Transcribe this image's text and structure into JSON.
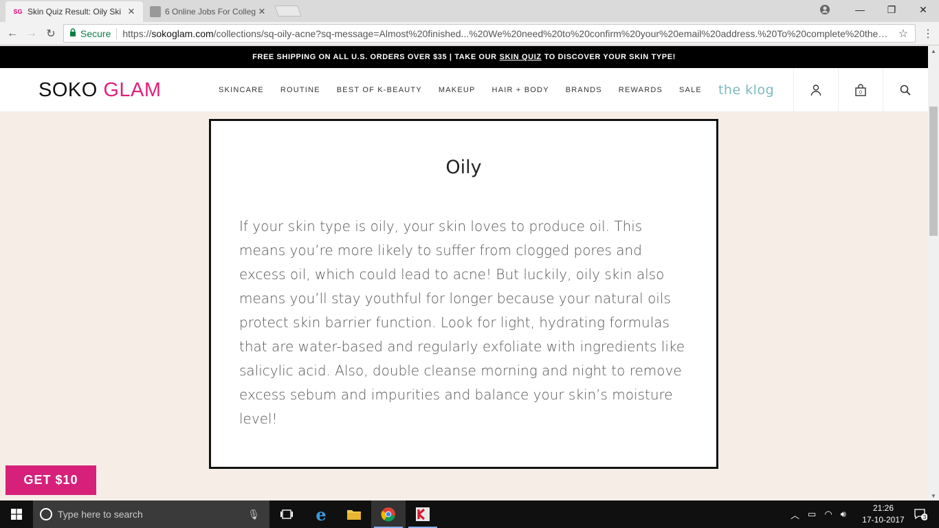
{
  "browser": {
    "tabs": [
      {
        "favicon": "SG",
        "title": "Skin Quiz Result: Oily Ski",
        "active": true
      },
      {
        "favicon": "image-favicon",
        "title": "6 Online Jobs For Colleg",
        "active": false
      }
    ],
    "close_glyph": "✕",
    "window_controls": {
      "minimize": "—",
      "restore": "❐",
      "close": "✕"
    },
    "nav": {
      "back": "←",
      "forward": "→",
      "reload": "↻"
    },
    "address": {
      "secure_label": "Secure",
      "url_scheme": "https://",
      "url_host": "sokoglam.com",
      "url_path": "/collections/sq-oily-acne?sq-message=Almost%20finished...%20We%20need%20to%20confirm%20your%20email%20address.%20To%20complete%20the%2..."
    },
    "icons": {
      "lock": "lock-icon",
      "star": "star-icon",
      "menu": "kebab-menu-icon",
      "profile": "profile-icon"
    }
  },
  "promo": {
    "text_before": "FREE SHIPPING ON ALL U.S. ORDERS OVER $35 | TAKE OUR",
    "link": "SKIN QUIZ",
    "text_after": "TO DISCOVER YOUR SKIN TYPE!"
  },
  "header": {
    "logo_part1": "SOKO",
    "logo_part2": "GLAM",
    "nav": [
      "SKINCARE",
      "ROUTINE",
      "BEST OF K-BEAUTY",
      "MAKEUP",
      "HAIR + BODY",
      "BRANDS",
      "REWARDS",
      "SALE"
    ],
    "klog": "the klog",
    "cart_count": "0"
  },
  "result": {
    "title": "Oily",
    "body": "If your skin type is oily, your skin loves to produce oil. This means you’re more likely to suffer from clogged pores and excess oil, which could lead to acne! But luckily, oily skin also means you’ll stay youthful for longer because your natural oils protect skin barrier function. Look for light, hydrating formulas that are water-based and regularly exfoliate with ingredients like salicylic acid. Also, double cleanse morning and night to remove excess sebum and impurities and balance your skin’s moisture level!"
  },
  "cta": {
    "get10": "GET $10"
  },
  "taskbar": {
    "search_placeholder": "Type here to search",
    "time": "21:26",
    "date": "17-10-2017",
    "notification_count": "3"
  },
  "colors": {
    "brand_pink": "#e0207a",
    "klog_teal": "#7ab8bf",
    "page_bg": "#f5ede6"
  }
}
